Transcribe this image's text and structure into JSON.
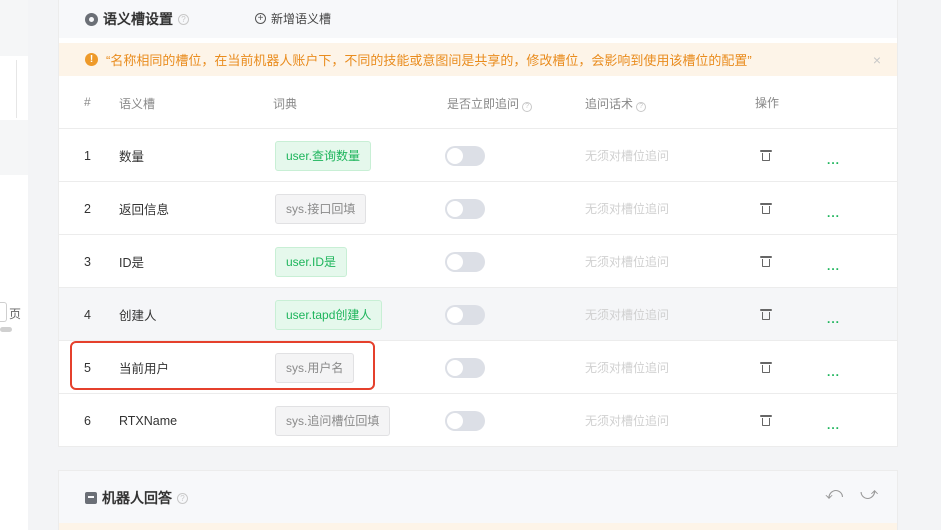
{
  "left_panel": {
    "page_char": "页"
  },
  "slot_section": {
    "title": "语义槽设置",
    "help_icon": "help-circle-icon",
    "add_button_label": "新增语义槽",
    "alert": {
      "icon": "warning-icon",
      "text": "“名称相同的槽位，在当前机器人账户下，不同的技能或意图间是共享的，修改槽位，会影响到使用该槽位的配置”",
      "close": "×"
    },
    "columns": {
      "idx": "#",
      "name": "语义槽",
      "dict": "词典",
      "ask_now": "是否立即追问",
      "followup": "追问话术",
      "action": "操作"
    },
    "rows": [
      {
        "idx": "1",
        "name": "数量",
        "dict": "user.查询数量",
        "dict_type": "user",
        "followup": "无须对槽位追问",
        "more": "...",
        "enabled": false
      },
      {
        "idx": "2",
        "name": "返回信息",
        "dict": "sys.接口回填",
        "dict_type": "sys",
        "followup": "无须对槽位追问",
        "more": "...",
        "enabled": false
      },
      {
        "idx": "3",
        "name": "ID是",
        "dict": "user.ID是",
        "dict_type": "user",
        "followup": "无须对槽位追问",
        "more": "...",
        "enabled": false
      },
      {
        "idx": "4",
        "name": "创建人",
        "dict": "user.tapd创建人",
        "dict_type": "user",
        "followup": "无须对槽位追问",
        "more": "...",
        "enabled": false
      },
      {
        "idx": "5",
        "name": "当前用户",
        "dict": "sys.用户名",
        "dict_type": "sys",
        "followup": "无须对槽位追问",
        "more": "...",
        "enabled": false
      },
      {
        "idx": "6",
        "name": "RTXName",
        "dict": "sys.追问槽位回填",
        "dict_type": "sys",
        "followup": "无须对槽位追问",
        "more": "...",
        "enabled": false
      }
    ]
  },
  "robot_section": {
    "title": "机器人回答",
    "undo_glyph": "⤺",
    "redo_glyph": "⤻"
  },
  "colors": {
    "accent_green": "#1eb55c",
    "warning_orange": "#e98c1e",
    "highlight_red": "#e5402c"
  }
}
